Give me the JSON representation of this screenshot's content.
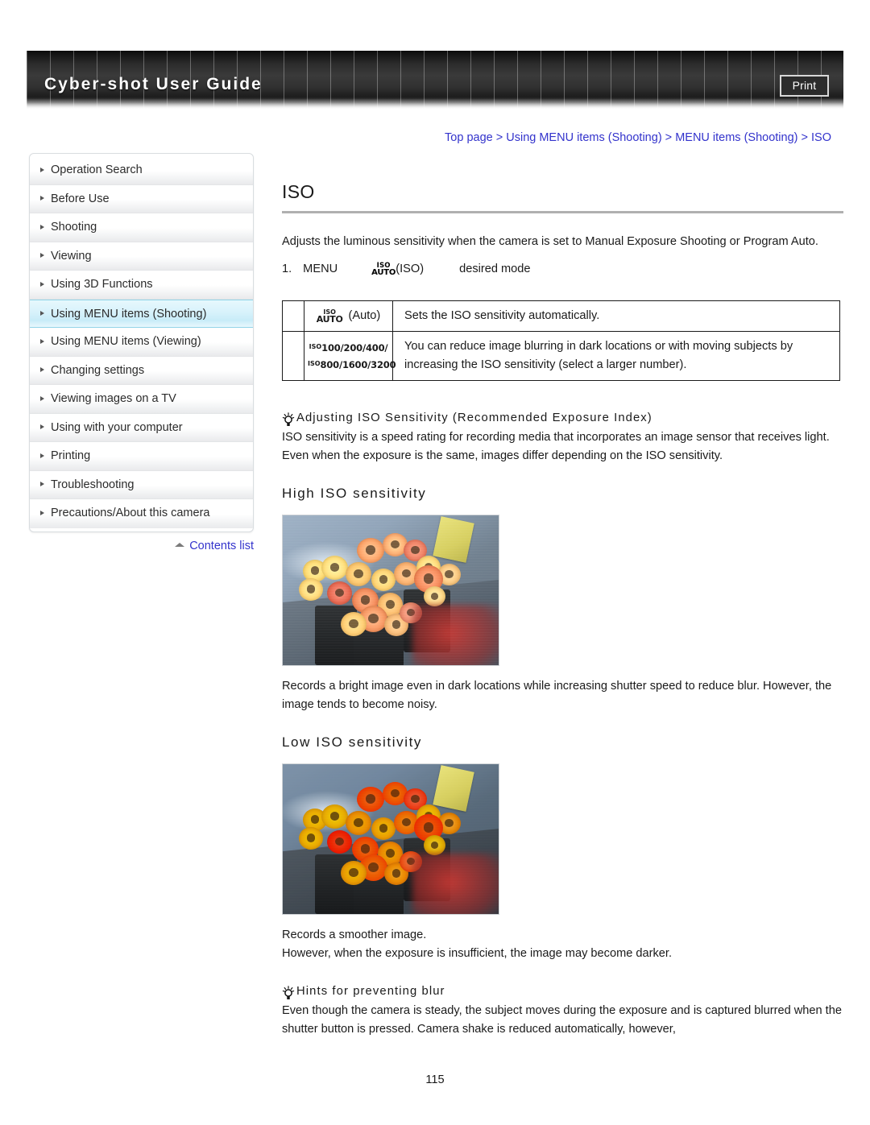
{
  "header": {
    "title": "Cyber-shot User Guide",
    "print_label": "Print"
  },
  "breadcrumb": {
    "items": [
      "Top page",
      "Using MENU items (Shooting)",
      "MENU items (Shooting)",
      "ISO"
    ],
    "separator": ">",
    "full_text": "Top page > Using MENU items (Shooting) > MENU items (Shooting) > ISO",
    "link_color": "#3333cc"
  },
  "sidebar": {
    "items": [
      {
        "label": "Operation Search",
        "active": false
      },
      {
        "label": "Before Use",
        "active": false
      },
      {
        "label": "Shooting",
        "active": false
      },
      {
        "label": "Viewing",
        "active": false
      },
      {
        "label": "Using 3D Functions",
        "active": false
      },
      {
        "label": "Using MENU items (Shooting)",
        "active": true
      },
      {
        "label": "Using MENU items (Viewing)",
        "active": false
      },
      {
        "label": "Changing settings",
        "active": false
      },
      {
        "label": "Viewing images on a TV",
        "active": false
      },
      {
        "label": "Using with your computer",
        "active": false
      },
      {
        "label": "Printing",
        "active": false
      },
      {
        "label": "Troubleshooting",
        "active": false
      },
      {
        "label": "Precautions/About this camera",
        "active": false
      }
    ],
    "contents_list_label": "Contents list",
    "active_highlight_color": "#c8ecf8"
  },
  "main": {
    "title": "ISO",
    "intro": "Adjusts the luminous sensitivity when the camera is set to Manual Exposure Shooting or Program Auto.",
    "step": {
      "number": "1.",
      "menu_label": "MENU",
      "icon_top": "ISO",
      "icon_bottom": "AUTO",
      "icon_caption": "(ISO)",
      "result": "desired mode"
    },
    "table": {
      "rows": [
        {
          "icon_top": "ISO",
          "icon_bottom": "AUTO",
          "icon_label": "(Auto)",
          "description": "Sets the ISO sensitivity automatically."
        },
        {
          "icon_row1_sup": "ISO",
          "icon_row1_values": "100/200/400/",
          "icon_row2_sup": "ISO",
          "icon_row2_values": "800/1600/3200",
          "description": "You can reduce image blurring in dark locations or with moving subjects by increasing the ISO sensitivity (select a larger number)."
        }
      ]
    },
    "tip1": {
      "heading": "Adjusting ISO Sensitivity (Recommended Exposure Index)",
      "body": "ISO sensitivity is a speed rating for recording media that incorporates an image sensor that receives light. Even when the exposure is the same, images differ depending on the ISO sensitivity."
    },
    "high_iso": {
      "heading": "High ISO sensitivity",
      "photo_alt": "Bright photo of orange and yellow gerbera flowers in black pots",
      "caption": "Records a bright image even in dark locations while increasing shutter speed to reduce blur. However, the image tends to become noisy."
    },
    "low_iso": {
      "heading": "Low ISO sensitivity",
      "photo_alt": "Darker, more saturated photo of orange and red gerbera flowers in black pots",
      "caption_line1": "Records a smoother image.",
      "caption_line2": "However, when the exposure is insufficient, the image may become darker."
    },
    "tip2": {
      "heading": "Hints for preventing blur",
      "body": "Even though the camera is steady, the subject moves during the exposure and is captured blurred when the shutter button is pressed. Camera shake is reduced automatically, however,"
    }
  },
  "footer": {
    "page_number": "115"
  }
}
